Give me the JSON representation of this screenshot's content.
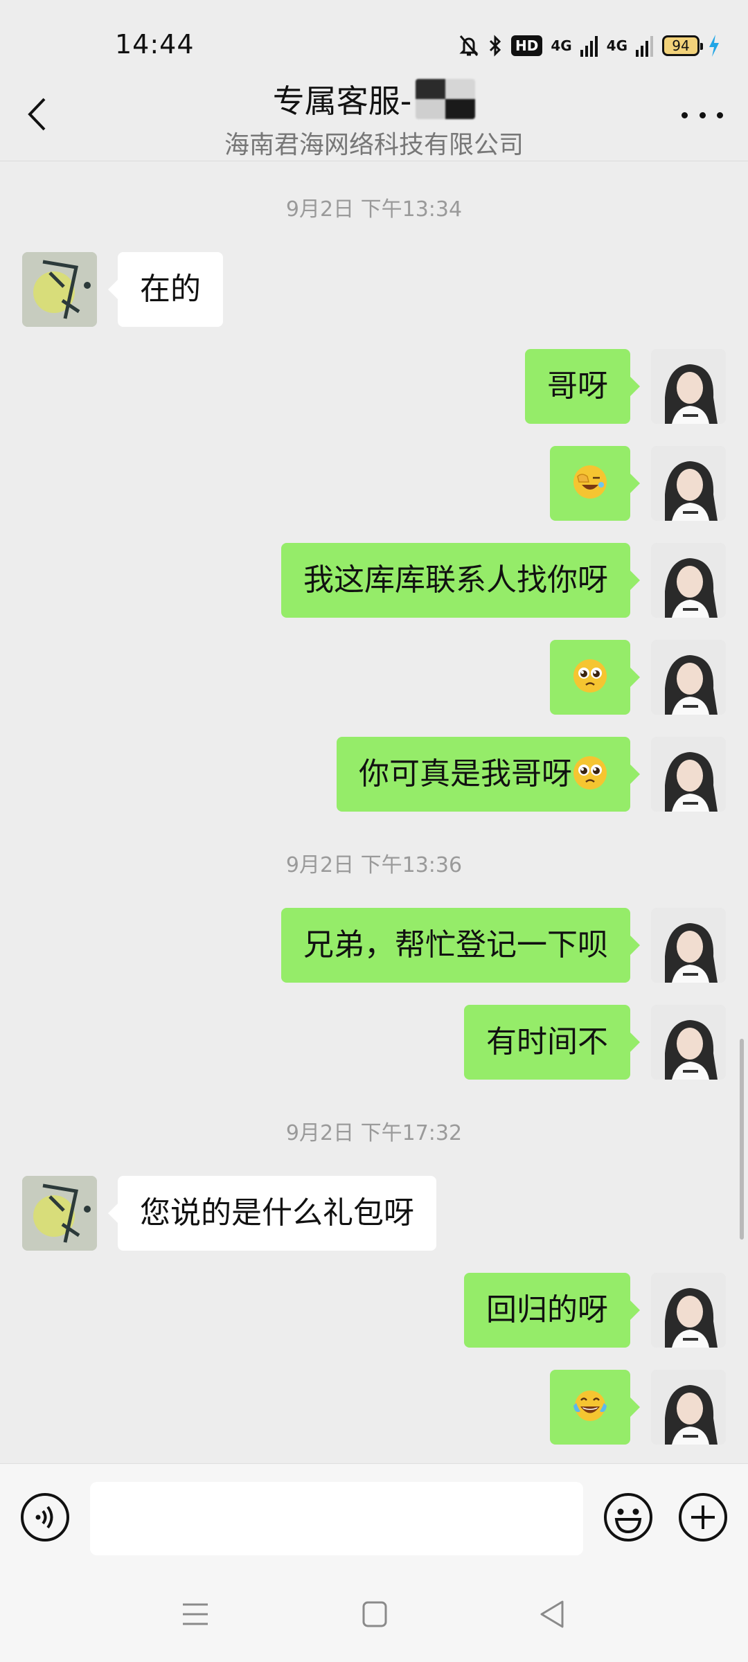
{
  "status_bar": {
    "time": "14:44",
    "hd_label": "HD",
    "net1": "4G",
    "net2": "4G",
    "battery": "94"
  },
  "header": {
    "title": "专属客服-",
    "subtitle": "海南君海网络科技有限公司",
    "icons": {
      "back": "back-chevron-icon",
      "more": "more-dots-icon"
    }
  },
  "chat": {
    "timestamps": [
      "9月2日 下午13:34",
      "9月2日 下午13:36",
      "9月2日 下午17:32"
    ],
    "messages": [
      {
        "side": "left",
        "text": "在的"
      },
      {
        "side": "right",
        "text": "哥呀"
      },
      {
        "side": "right",
        "text": "",
        "emoji": "facepalm-laugh"
      },
      {
        "side": "right",
        "text": "我这库库联系人找你呀"
      },
      {
        "side": "right",
        "text": "",
        "emoji": "pleading-face"
      },
      {
        "side": "right",
        "text": "你可真是我哥呀",
        "emoji": "pleading-face"
      },
      {
        "side": "right",
        "text": "兄弟，帮忙登记一下呗"
      },
      {
        "side": "right",
        "text": "有时间不"
      },
      {
        "side": "left",
        "text": "您说的是什么礼包呀"
      },
      {
        "side": "right",
        "text": "回归的呀"
      },
      {
        "side": "right",
        "text": "",
        "emoji": "tears-of-joy"
      }
    ]
  },
  "input_bar": {
    "placeholder": "",
    "icons": {
      "voice": "voice-icon",
      "emoji": "emoji-icon",
      "plus": "plus-icon"
    }
  },
  "colors": {
    "background": "#ededed",
    "bubble_self": "#95ec69",
    "bubble_other": "#ffffff",
    "timestamp": "#9a9a9a"
  }
}
